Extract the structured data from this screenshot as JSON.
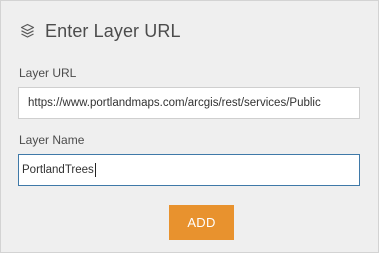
{
  "dialog": {
    "title": "Enter Layer URL",
    "title_icon": "layers-icon"
  },
  "fields": {
    "url_label": "Layer URL",
    "url_value": "https://www.portlandmaps.com/arcgis/rest/services/Public",
    "name_label": "Layer Name",
    "name_value": "PortlandTrees"
  },
  "actions": {
    "add_label": "ADD"
  },
  "colors": {
    "accent": "#e8922e",
    "focus_border": "#3f79a8",
    "panel_bg": "#efefef"
  }
}
